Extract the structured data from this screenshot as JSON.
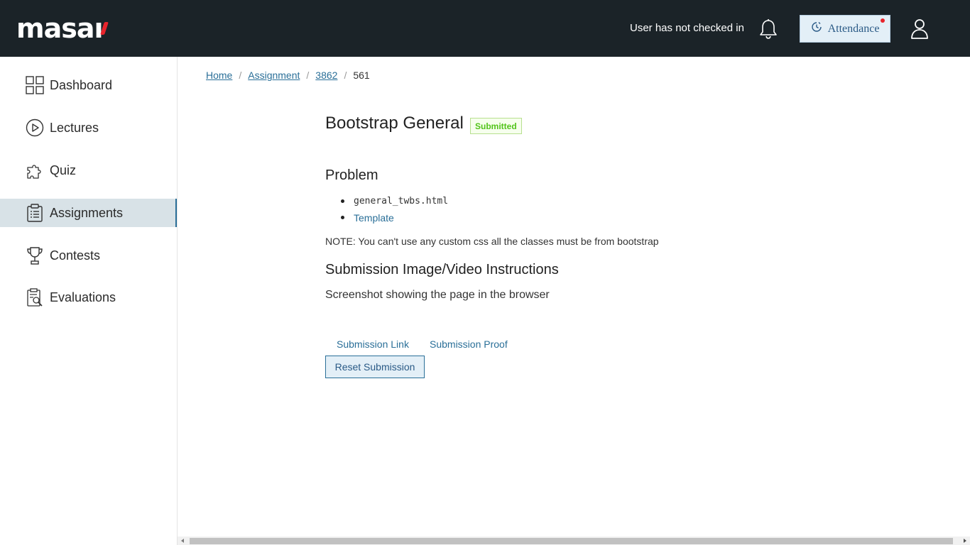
{
  "header": {
    "logo_text": "masa",
    "checkin_status": "User has not checked in",
    "attendance_label": "Attendance",
    "bell_icon": "bell-icon",
    "user_icon": "user-icon",
    "colors": {
      "background": "#1b2328",
      "accent": "#e8242c"
    }
  },
  "sidebar": {
    "items": [
      {
        "label": "Dashboard",
        "icon": "grid-icon",
        "active": false
      },
      {
        "label": "Lectures",
        "icon": "play-circle-icon",
        "active": false
      },
      {
        "label": "Quiz",
        "icon": "puzzle-icon",
        "active": false
      },
      {
        "label": "Assignments",
        "icon": "clipboard-icon",
        "active": true
      },
      {
        "label": "Contests",
        "icon": "trophy-icon",
        "active": false
      },
      {
        "label": "Evaluations",
        "icon": "report-search-icon",
        "active": false
      }
    ]
  },
  "breadcrumb": {
    "home": "Home",
    "assignment": "Assignment",
    "id": "3862",
    "current": "561",
    "separator": "/"
  },
  "main": {
    "title": "Bootstrap General",
    "status_badge": "Submitted",
    "problem_heading": "Problem",
    "problem_items": {
      "file": "general_twbs.html",
      "template_link": "Template"
    },
    "note": "NOTE: You can't use any custom css all the classes must be from bootstrap",
    "submission_heading": "Submission Image/Video Instructions",
    "instructions": "Screenshot showing the page in the browser",
    "submission_link": "Submission Link",
    "submission_proof": "Submission Proof",
    "reset_button": "Reset Submission"
  }
}
